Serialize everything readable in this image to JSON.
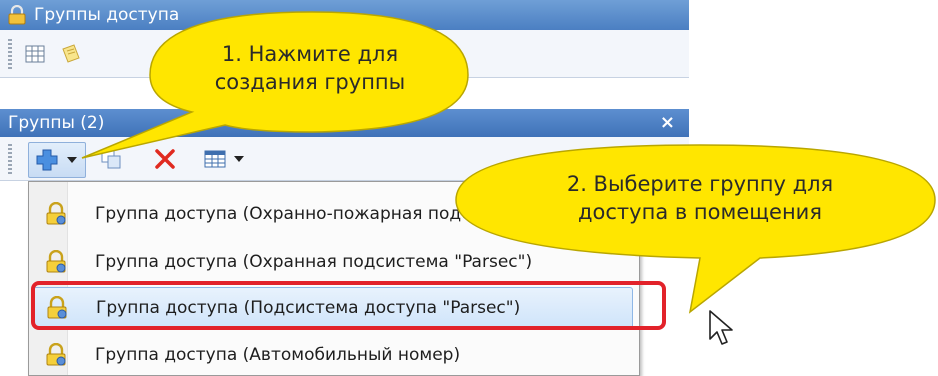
{
  "window": {
    "title": "Группы доступа"
  },
  "panel": {
    "title": "Группы (2)",
    "close_label": "×"
  },
  "menu": {
    "items": [
      {
        "label": "Группа доступа (Охранно-пожарная подсистема \"Parsec\")",
        "icon": "lock-user-icon"
      },
      {
        "label": "Группа доступа (Охранная подсистема \"Parsec\")",
        "icon": "lock-user-icon"
      },
      {
        "label": "Группа доступа (Подсистема доступа \"Parsec\")",
        "icon": "lock-user-icon",
        "highlighted": true
      },
      {
        "label": "Группа доступа (Автомобильный номер)",
        "icon": "lock-user-icon"
      }
    ]
  },
  "callouts": {
    "first": {
      "line1": "1. Нажмите для",
      "line2": "создания группы"
    },
    "second": {
      "line1": "2. Выберите группу для",
      "line2": "доступа в помещения"
    }
  },
  "colors": {
    "callout_fill": "#ffe600",
    "highlight_frame": "#e2222a",
    "titlebar": "#4b7fc2"
  }
}
